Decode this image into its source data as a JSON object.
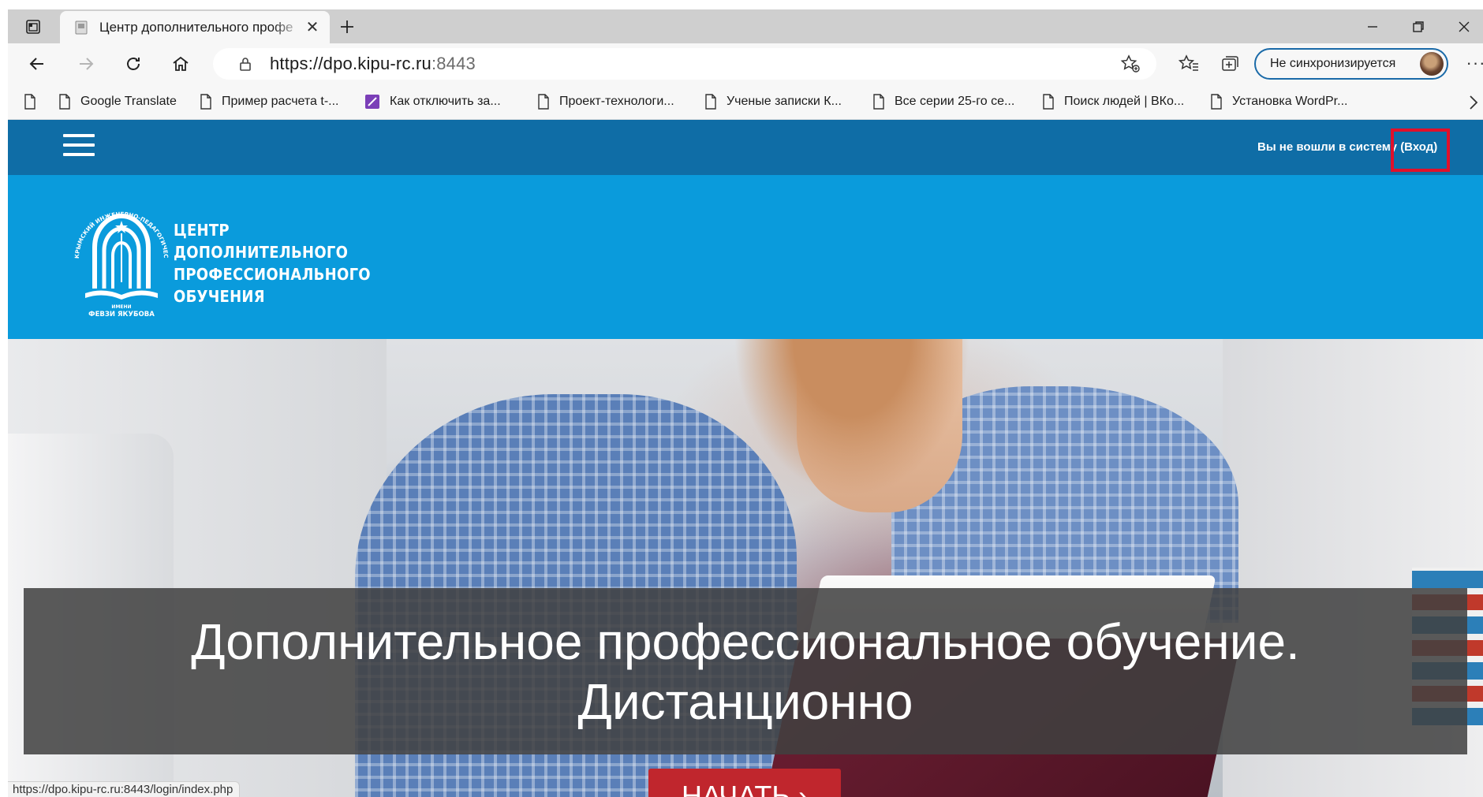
{
  "browser": {
    "tab_title": "Центр дополнительного профе",
    "url_main": "https://dpo.kipu-rc.ru",
    "url_port": ":8443",
    "sync_label": "Не синхронизируется",
    "bookmarks": [
      {
        "label": "Google Translate"
      },
      {
        "label": "Пример расчета t-..."
      },
      {
        "label": "Как отключить за..."
      },
      {
        "label": "Проект-технологи..."
      },
      {
        "label": "Ученые записки К..."
      },
      {
        "label": "Все серии 25-го се..."
      },
      {
        "label": "Поиск людей | ВКо..."
      },
      {
        "label": "Установка WordPr..."
      }
    ],
    "status_url": "https://dpo.kipu-rc.ru:8443/login/index.php"
  },
  "site": {
    "login_prefix": "Вы не вошли в систему",
    "login_link": "(Вход)",
    "brand_lines": [
      "ЦЕНТР",
      "ДОПОЛНИТЕЛЬНОГО",
      "ПРОФЕССИОНАЛЬНОГО",
      "ОБУЧЕНИЯ"
    ],
    "emblem_text_top": "КРЫМСКИЙ ИНЖЕНЕРНО-ПЕДАГОГИЧЕСКИЙ УНИВЕРСИТЕТ",
    "emblem_text_bottom_1": "ИМЕНИ",
    "emblem_text_bottom_2": "ФЕВЗИ ЯКУБОВА",
    "hero_line_1": "Дополнительное профессиональное обучение.",
    "hero_line_2": "Дистанционно",
    "start_button": "НАЧАТЬ ›"
  },
  "colors": {
    "topnav": "#0f6da6",
    "brandband": "#0a9bdc",
    "start_button": "#c0262d",
    "highlight": "#e0102a"
  }
}
